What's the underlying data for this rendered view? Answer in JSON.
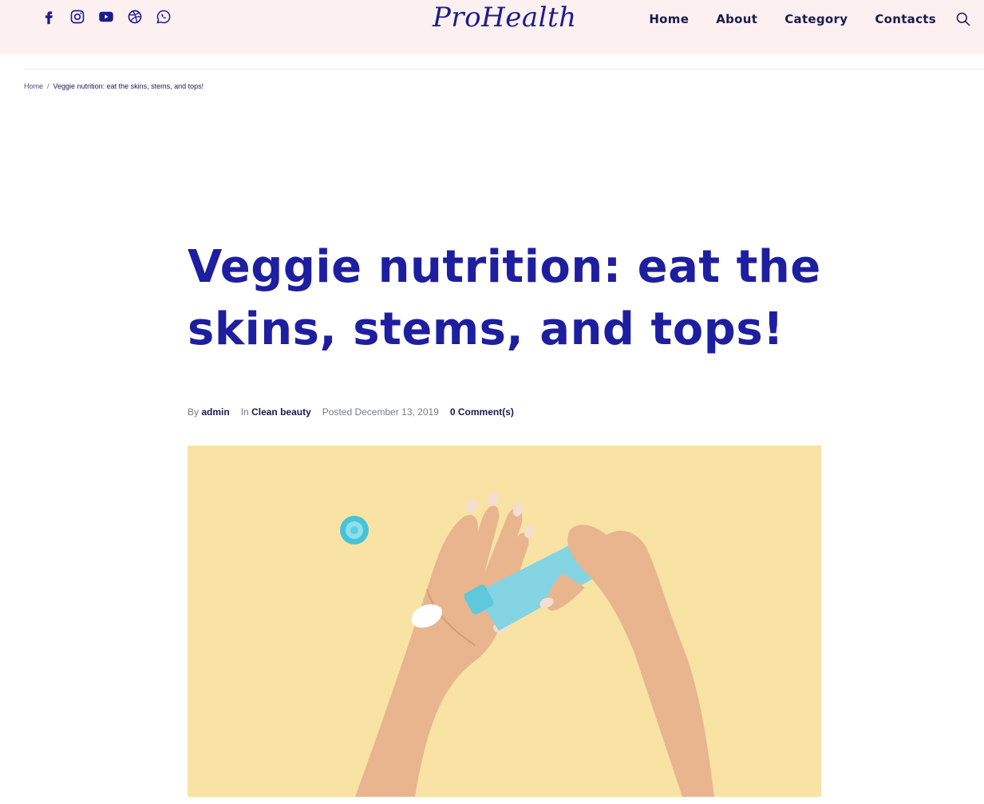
{
  "header": {
    "logo": "ProHealth",
    "social": [
      {
        "icon": "facebook-icon"
      },
      {
        "icon": "instagram-icon"
      },
      {
        "icon": "youtube-icon"
      },
      {
        "icon": "dribbble-icon"
      },
      {
        "icon": "whatsapp-icon"
      }
    ],
    "nav": [
      {
        "label": "Home"
      },
      {
        "label": "About"
      },
      {
        "label": "Category"
      },
      {
        "label": "Contacts"
      }
    ],
    "search_icon": "search-icon",
    "background": "#fdf0f1"
  },
  "breadcrumb": {
    "home": "Home",
    "separator": "/",
    "current": "Veggie nutrition: eat the skins, stems, and tops!"
  },
  "article": {
    "title": "Veggie nutrition: eat the skins, stems, and tops!",
    "meta": {
      "by_label": "By",
      "author": "admin",
      "in_label": "In",
      "category": "Clean beauty",
      "posted": "Posted December 13, 2019",
      "comments": "0 Comment(s)"
    },
    "title_color": "#1e1ea0",
    "hero_background": "#f9e3a4"
  }
}
